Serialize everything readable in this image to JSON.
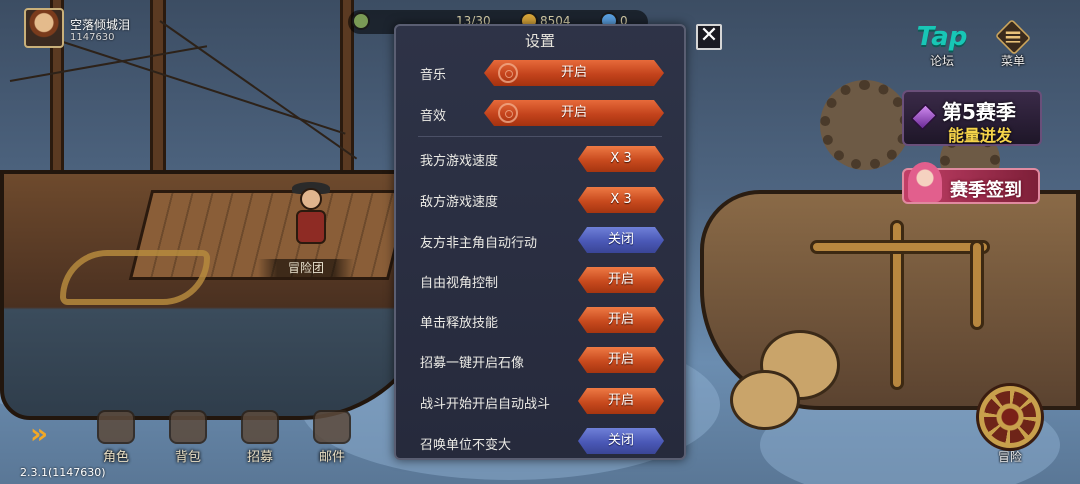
{
  "player": {
    "name": "空落倾城泪",
    "id": "1147630"
  },
  "resources": [
    {
      "text": "13/30",
      "color": "#7a9a55"
    },
    {
      "text": "8504",
      "color": "#d9a63a"
    },
    {
      "text": "0",
      "color": "#5aa0e0"
    }
  ],
  "hud": {
    "tap_logo": "Tap",
    "forum_label": "论坛",
    "menu_label": "菜单"
  },
  "season": {
    "title": "第5赛季",
    "subtitle": "能量迸发",
    "sign_label": "赛季签到"
  },
  "scene": {
    "adventure_group_label": "冒险团"
  },
  "bottom_nav": {
    "items": [
      {
        "label": "角色"
      },
      {
        "label": "背包"
      },
      {
        "label": "招募"
      },
      {
        "label": "邮件"
      }
    ],
    "adventure_label": "冒险"
  },
  "version": "2.3.1(1147630)",
  "settings": {
    "title": "设置",
    "close_glyph": "✕",
    "audio": [
      {
        "label": "音乐",
        "value": "开启"
      },
      {
        "label": "音效",
        "value": "开启"
      }
    ],
    "options": [
      {
        "label": "我方游戏速度",
        "value": "X 3",
        "state": "on"
      },
      {
        "label": "敌方游戏速度",
        "value": "X 3",
        "state": "on"
      },
      {
        "label": "友方非主角自动行动",
        "value": "关闭",
        "state": "off"
      },
      {
        "label": "自由视角控制",
        "value": "开启",
        "state": "on"
      },
      {
        "label": "单击释放技能",
        "value": "开启",
        "state": "on"
      },
      {
        "label": "招募一键开启石像",
        "value": "开启",
        "state": "on"
      },
      {
        "label": "战斗开始开启自动战斗",
        "value": "开启",
        "state": "on"
      },
      {
        "label": "召唤单位不变大",
        "value": "关闭",
        "state": "off"
      }
    ]
  },
  "colors": {
    "toggle_on": "#c84a1e",
    "toggle_off": "#4a58b6",
    "dialog_bg": "#2a2e42",
    "accent_tap": "#18c6b6"
  }
}
